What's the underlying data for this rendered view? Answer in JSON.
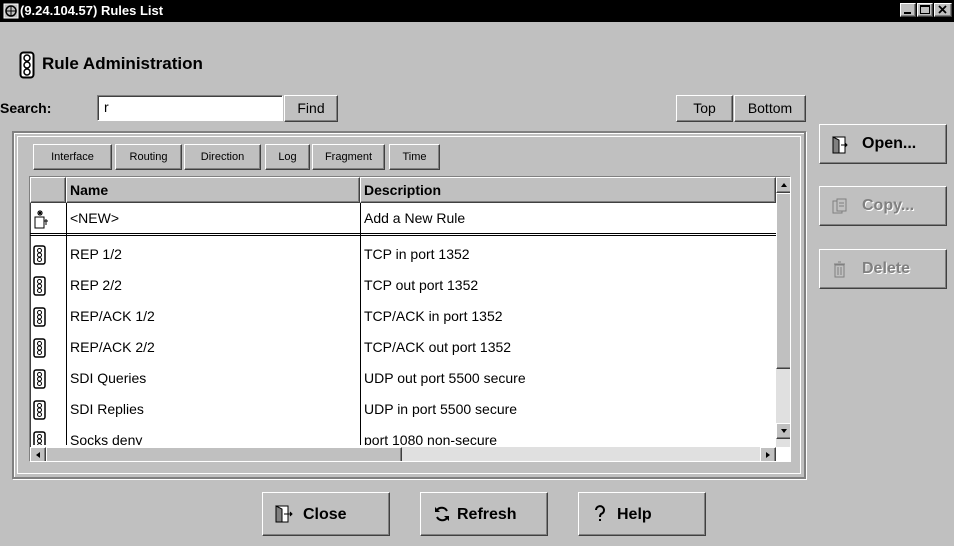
{
  "window": {
    "title": "(9.24.104.57) Rules List",
    "controls": [
      "minimize",
      "maximize",
      "close"
    ]
  },
  "header": {
    "title": "Rule Administration",
    "icon": "traffic-light-icon"
  },
  "search": {
    "label": "Search:",
    "value": "r",
    "find_label": "Find",
    "top_label": "Top",
    "bottom_label": "Bottom"
  },
  "filters": [
    "Interface",
    "Routing",
    "Direction",
    "Log",
    "Fragment",
    "Time"
  ],
  "table": {
    "columns": [
      "Name",
      "Description"
    ],
    "rows": [
      {
        "name": "<NEW>",
        "description": "Add a New Rule",
        "icon": "new-rule-icon"
      },
      {
        "name": "REP 1/2",
        "description": "TCP in port 1352",
        "icon": "traffic-light-icon"
      },
      {
        "name": "REP 2/2",
        "description": "TCP out port 1352",
        "icon": "traffic-light-icon"
      },
      {
        "name": "REP/ACK 1/2",
        "description": "TCP/ACK in port 1352",
        "icon": "traffic-light-icon"
      },
      {
        "name": "REP/ACK 2/2",
        "description": "TCP/ACK out port 1352",
        "icon": "traffic-light-icon"
      },
      {
        "name": "SDI Queries",
        "description": "UDP out port 5500 secure",
        "icon": "traffic-light-icon"
      },
      {
        "name": "SDI Replies",
        "description": "UDP in port 5500 secure",
        "icon": "traffic-light-icon"
      },
      {
        "name": "Socks deny",
        "description": "port 1080 non-secure",
        "icon": "traffic-light-icon"
      }
    ]
  },
  "side_buttons": {
    "open": "Open...",
    "copy": "Copy...",
    "delete": "Delete"
  },
  "bottom_buttons": {
    "close": "Close",
    "refresh": "Refresh",
    "help": "Help"
  },
  "colors": {
    "face": "#c0c0c0",
    "titlebar": "#000000",
    "disabled_text": "#808080"
  }
}
